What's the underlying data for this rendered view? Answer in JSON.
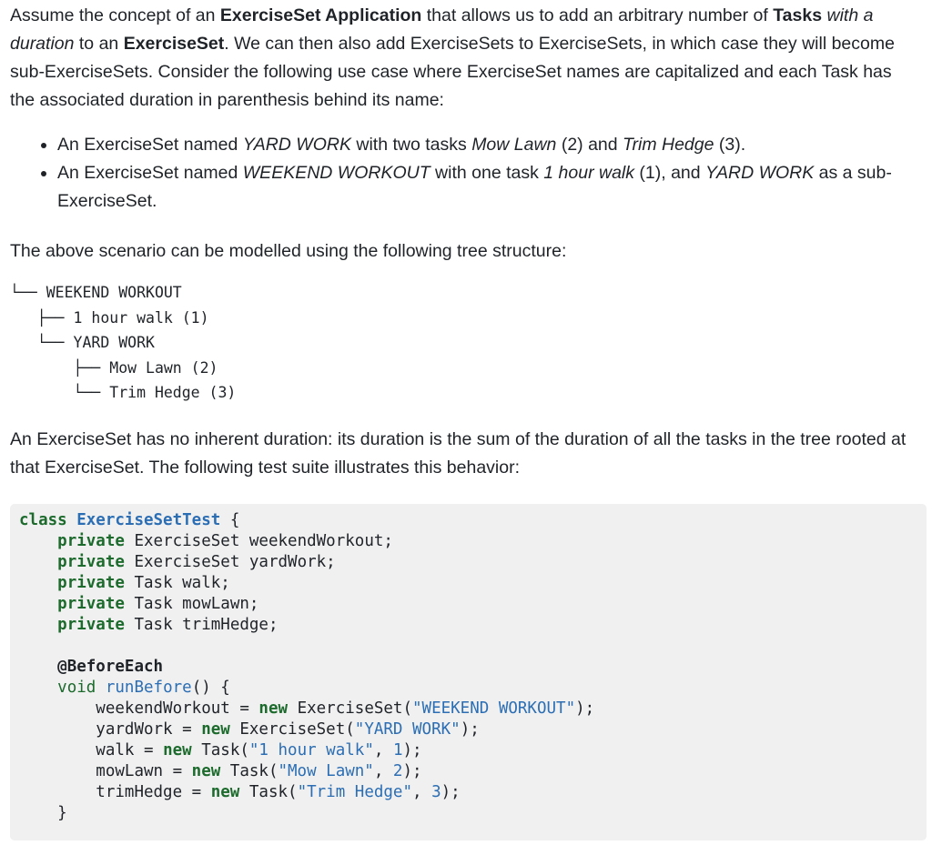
{
  "intro": {
    "t1": "Assume the concept of an ",
    "t2": "ExerciseSet Application",
    "t3": " that allows us to add an arbitrary number of ",
    "t4": "Tasks",
    "t5": "with a duration",
    "t6": " to an ",
    "t7": "ExerciseSet",
    "t8": ". We can then also add ExerciseSets to ExerciseSets, in which case they will become sub-ExerciseSets. Consider the following use case where ExerciseSet names are capitalized and each Task has the associated duration in parenthesis behind its name:"
  },
  "bullets": [
    {
      "a": "An ExerciseSet named ",
      "b": "YARD WORK",
      "c": " with two tasks ",
      "d": "Mow Lawn",
      "e": " (2) and ",
      "f": "Trim Hedge",
      "g": " (3)."
    },
    {
      "a": "An ExerciseSet named ",
      "b": "WEEKEND WORKOUT",
      "c": " with one task ",
      "d": "1 hour walk",
      "e": " (1), and ",
      "f": "YARD WORK",
      "g": " as a sub-ExerciseSet."
    }
  ],
  "scenario_text": "The above scenario can be modelled using the following tree structure:",
  "tree": [
    "└── WEEKEND WORKOUT",
    "   ├── 1 hour walk (1)",
    "   └── YARD WORK",
    "       ├── Mow Lawn (2)",
    "       └── Trim Hedge (3)"
  ],
  "duration_text": "An ExerciseSet has no inherent duration: its duration is the sum of the duration of all the tasks in the tree rooted at that ExerciseSet. The following test suite illustrates this behavior:",
  "code": {
    "kw_class": "class",
    "class_name": "ExerciseSetTest",
    "open_brace": " {",
    "kw_private": "private",
    "fields": [
      " ExerciseSet weekendWorkout;",
      " ExerciseSet yardWork;",
      " Task walk;",
      " Task mowLawn;",
      " Task trimHedge;"
    ],
    "annotation": "@BeforeEach",
    "kw_void": "void",
    "method_name": "runBefore",
    "method_sig_rest": "() {",
    "kw_new": "new",
    "assignments": [
      {
        "lhs": "weekendWorkout = ",
        "ctor": " ExerciseSet(",
        "str": "\"WEEKEND WORKOUT\"",
        "num": "",
        "end": ");"
      },
      {
        "lhs": "yardWork = ",
        "ctor": " ExerciseSet(",
        "str": "\"YARD WORK\"",
        "num": "",
        "end": ");"
      },
      {
        "lhs": "walk = ",
        "ctor": " Task(",
        "str": "\"1 hour walk\"",
        "num": "1",
        "end": ");"
      },
      {
        "lhs": "mowLawn = ",
        "ctor": " Task(",
        "str": "\"Mow Lawn\"",
        "num": "2",
        "end": ");"
      },
      {
        "lhs": "trimHedge = ",
        "ctor": " Task(",
        "str": "\"Trim Hedge\"",
        "num": "3",
        "end": ");"
      }
    ],
    "close_brace": "}"
  }
}
